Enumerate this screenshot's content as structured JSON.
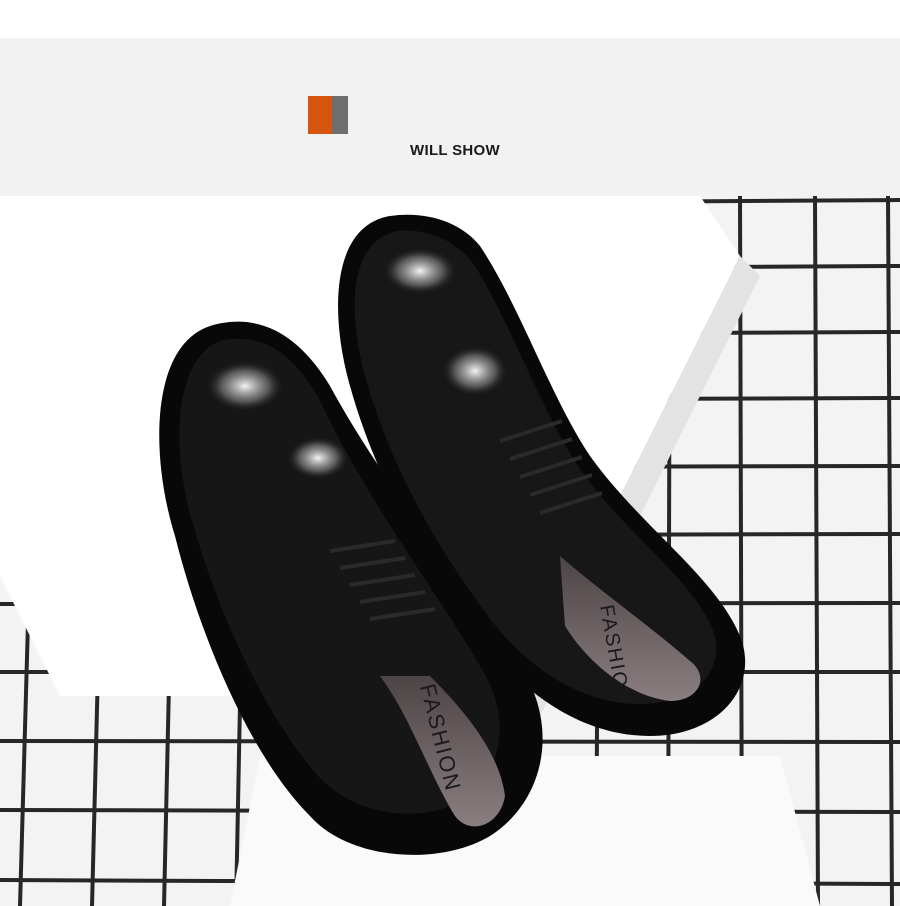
{
  "header": {
    "title": "WILL SHOW",
    "accent_colors": [
      "#d4570d",
      "#6e6e6e"
    ]
  },
  "photo": {
    "subject": "pair of black patent leather lace-up shoes",
    "insole_print": "FASHION",
    "colors": {
      "background": "#f3f3f3",
      "grid_lines": "#111111",
      "box": "#ffffff",
      "leather": "#0b0b0b",
      "insole": "#6b6062"
    }
  }
}
